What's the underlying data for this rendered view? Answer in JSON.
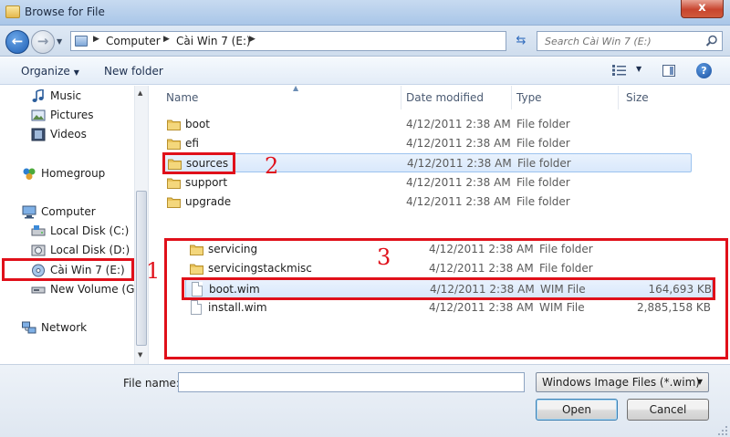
{
  "window": {
    "title": "Browse for File",
    "close_label": "x"
  },
  "address": {
    "crumbs": [
      "Computer",
      "Cài Win 7 (E:)"
    ],
    "search_placeholder": "Search Cài Win 7 (E:)"
  },
  "toolbar": {
    "organize_label": "Organize",
    "new_folder_label": "New folder"
  },
  "nav": {
    "items": [
      {
        "label": "Music"
      },
      {
        "label": "Pictures"
      },
      {
        "label": "Videos"
      },
      {
        "label": "Homegroup"
      },
      {
        "label": "Computer"
      },
      {
        "label": "Local Disk (C:)"
      },
      {
        "label": "Local Disk (D:)"
      },
      {
        "label": "Cài Win 7 (E:)"
      },
      {
        "label": "New Volume (G:)"
      },
      {
        "label": "Network"
      }
    ]
  },
  "columns": {
    "name": "Name",
    "date": "Date modified",
    "type": "Type",
    "size": "Size"
  },
  "rows": [
    {
      "name": "boot",
      "date": "4/12/2011 2:38 AM",
      "type": "File folder",
      "size": ""
    },
    {
      "name": "efi",
      "date": "4/12/2011 2:38 AM",
      "type": "File folder",
      "size": ""
    },
    {
      "name": "sources",
      "date": "4/12/2011 2:38 AM",
      "type": "File folder",
      "size": ""
    },
    {
      "name": "support",
      "date": "4/12/2011 2:38 AM",
      "type": "File folder",
      "size": ""
    },
    {
      "name": "upgrade",
      "date": "4/12/2011 2:38 AM",
      "type": "File folder",
      "size": ""
    }
  ],
  "inset_rows": [
    {
      "name": "servicing",
      "date": "4/12/2011 2:38 AM",
      "type": "File folder",
      "size": ""
    },
    {
      "name": "servicingstackmisc",
      "date": "4/12/2011 2:38 AM",
      "type": "File folder",
      "size": ""
    },
    {
      "name": "boot.wim",
      "date": "4/12/2011 2:38 AM",
      "type": "WIM File",
      "size": "164,693 KB"
    },
    {
      "name": "install.wim",
      "date": "4/12/2011 2:38 AM",
      "type": "WIM File",
      "size": "2,885,158 KB"
    }
  ],
  "annotations": {
    "n1": "1",
    "n2": "2",
    "n3": "3"
  },
  "footer": {
    "file_name_label": "File name:",
    "file_name_value": "",
    "filter_value": "Windows Image Files (*.wim)",
    "open_label": "Open",
    "cancel_label": "Cancel"
  },
  "colors": {
    "annotation_red": "#e0101a",
    "selection_border": "#9cc3ef"
  }
}
